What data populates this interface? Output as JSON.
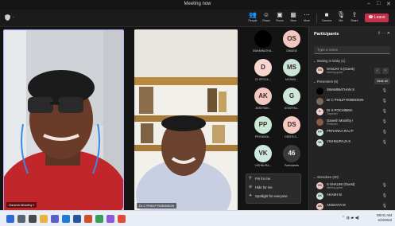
{
  "window": {
    "title": "Meeting now"
  },
  "toolbar": {
    "timer": "-",
    "buttons": [
      {
        "id": "people",
        "label": "People",
        "active": true
      },
      {
        "id": "react",
        "label": "React"
      },
      {
        "id": "room",
        "label": "Room"
      },
      {
        "id": "view",
        "label": "View"
      },
      {
        "id": "more",
        "label": "More"
      },
      {
        "id": "camera",
        "label": "Camera"
      },
      {
        "id": "mic",
        "label": "Mic"
      },
      {
        "id": "share",
        "label": "Share"
      }
    ],
    "leave_label": "Leave"
  },
  "videos": {
    "tile1_name": "Ganesh Moorthy I",
    "tile2_name": "Dr C PHILIP ROBINSON"
  },
  "gallery": [
    {
      "initials": "",
      "name": "SWAMINATHA...",
      "color": "#000000"
    },
    {
      "initials": "OS",
      "name": "OWAISE",
      "color": "#f3c7c0"
    },
    {
      "initials": "D",
      "name": "Dr SPOCK...",
      "color": "#f6d6cf"
    },
    {
      "initials": "MS",
      "name": "MOHAN...",
      "color": "#c9e3d6"
    },
    {
      "initials": "AK",
      "name": "AKSHYAN...",
      "color": "#f2c9c2"
    },
    {
      "initials": "G",
      "name": "GOWTHA...",
      "color": "#cfe6da"
    },
    {
      "initials": "PP",
      "name": "PRIYANKA...",
      "color": "#cbe8d6"
    },
    {
      "initials": "DS",
      "name": "DEEPA S...",
      "color": "#f3c9c2"
    },
    {
      "initials": "VK",
      "name": "VISHNURA...",
      "color": "#cde8dc"
    },
    {
      "initials": "46",
      "name": "Participants",
      "color": "#3a3a3a"
    }
  ],
  "pin_menu": {
    "items": [
      "Pin for me",
      "Hide for me",
      "Spotlight for everyone"
    ]
  },
  "participants_panel": {
    "title": "Participants",
    "search_placeholder": "Type a name",
    "lobby_header": "Waiting in lobby (1)",
    "lobby_person": {
      "initials": "SS",
      "name": "SANJAY S (Guest)",
      "role": "Meeting guest",
      "color": "#f3c9c2"
    },
    "presenters_header": "Presenters (6)",
    "mute_all_label": "Mute all",
    "presenters": [
      {
        "initials": "",
        "name": "SWAMINATHAN S",
        "role": "",
        "color": "#000000"
      },
      {
        "initials": "",
        "name": "Dr C PHILIP ROBINSON",
        "role": "",
        "color": "#7a6a5a"
      },
      {
        "initials": "D",
        "name": "Dr S POCHIMMA",
        "role": "Organizer",
        "color": "#f6d6cf"
      },
      {
        "initials": "",
        "name": "Ganesh Moorthy I",
        "role": "Presenter",
        "color": "#8a5a44"
      },
      {
        "initials": "PP",
        "name": "PRIYANKA RAJ P",
        "role": "",
        "color": "#cbe8d6"
      },
      {
        "initials": "VK",
        "name": "VISHNURAJA K",
        "role": "",
        "color": "#cde8dc"
      }
    ],
    "attendees_header": "Attendees (40)",
    "attendees": [
      {
        "initials": "SS",
        "name": "S SHALINI (Guest)",
        "role": "Meeting guest",
        "color": "#f3c9c2"
      },
      {
        "initials": "AK",
        "name": "AKASH M",
        "role": "",
        "color": "#cfe6da"
      },
      {
        "initials": "AK",
        "name": "AKSHAYA M",
        "role": "",
        "color": "#f2c9c2"
      }
    ]
  },
  "taskbar": {
    "clock_time": "08:01 AM",
    "clock_date": "2/4/2023"
  }
}
